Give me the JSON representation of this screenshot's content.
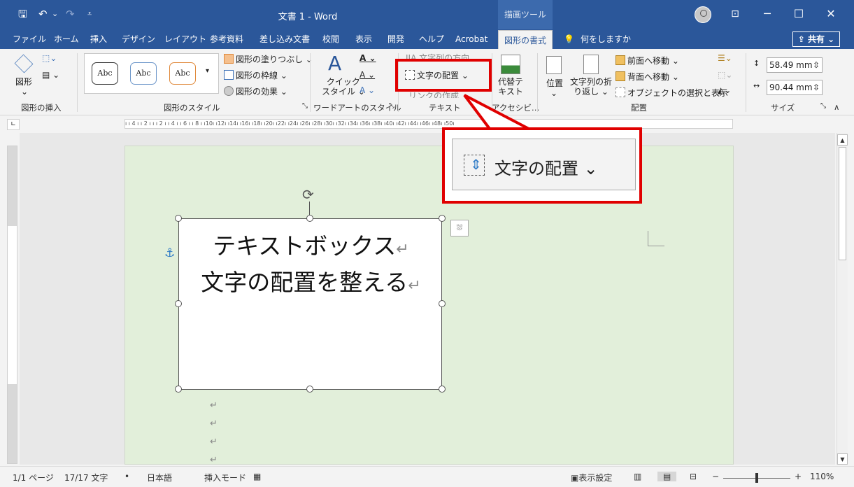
{
  "window": {
    "title": "文書 1 - Word",
    "context_tab": "描画ツール",
    "controls": {
      "ribbon_display": "⊡",
      "minimize": "─",
      "maximize": "☐",
      "close": "✕"
    },
    "quick_access": {
      "save": "🖫",
      "undo": "↶",
      "undo_dropdown": "⌄",
      "redo": "↷",
      "customize": "⩡"
    }
  },
  "tabs": [
    "ファイル",
    "ホーム",
    "挿入",
    "デザイン",
    "レイアウト",
    "参考資料",
    "差し込み文書",
    "校閲",
    "表示",
    "開発",
    "ヘルプ",
    "Acrobat",
    "図形の書式"
  ],
  "tell_me": "何をしますか",
  "share_label": "共有",
  "ribbon": {
    "insert_shapes": {
      "shapes_label": "図形",
      "group_label": "図形の挿入"
    },
    "shape_styles": {
      "presets": [
        "Abc",
        "Abc",
        "Abc"
      ],
      "fill": "図形の塗りつぶし ⌄",
      "outline": "図形の枠線 ⌄",
      "effects": "図形の効果 ⌄",
      "group_label": "図形のスタイル"
    },
    "wordart": {
      "quick_styles": "クイック\nスタイル ⌄",
      "group_label": "ワードアートのスタイル"
    },
    "text": {
      "direction": "文字列の方向",
      "align": "文字の配置 ⌄",
      "link": "リンクの作成",
      "group_label": "テキスト"
    },
    "accessibility": {
      "alt_text": "代替テ\nキスト",
      "group_label": "アクセシビ…"
    },
    "arrange": {
      "position": "位置",
      "wrap": "文字列の折\nり返し ⌄",
      "bring_forward": "前面へ移動  ⌄",
      "send_backward": "背面へ移動  ⌄",
      "selection_pane": "オブジェクトの選択と表示",
      "group_label": "配置"
    },
    "size": {
      "height": "58.49 mm",
      "width": "90.44 mm",
      "group_label": "サイズ"
    }
  },
  "ruler_text": "ı ı 4 ı ı 2 ı ı ı 2 ı ı 4 ı ı 6 ı ı 8 ı ı10ı ı12ı ı14ı ı16ı ı18ı ı20ı ı22ı ı24ı ı26ı ı28ı ı30ı ı32ı ı34ı ı36ı ı38ı ı40ı ı42ı ı44ı ı46ı ı48ı ı50ı",
  "callout": {
    "label": "文字の配置 ⌄"
  },
  "textbox": {
    "line1": "テキストボックス",
    "line2": "文字の配置を整える"
  },
  "status": {
    "page": "1/1 ページ",
    "words": "17/17 文字",
    "language": "日本語",
    "mode": "挿入モード",
    "display_settings": "表示設定",
    "zoom": "110%"
  },
  "colors": {
    "title_bar": "#2b579a",
    "highlight": "#e00000",
    "page": "#e2efda"
  }
}
